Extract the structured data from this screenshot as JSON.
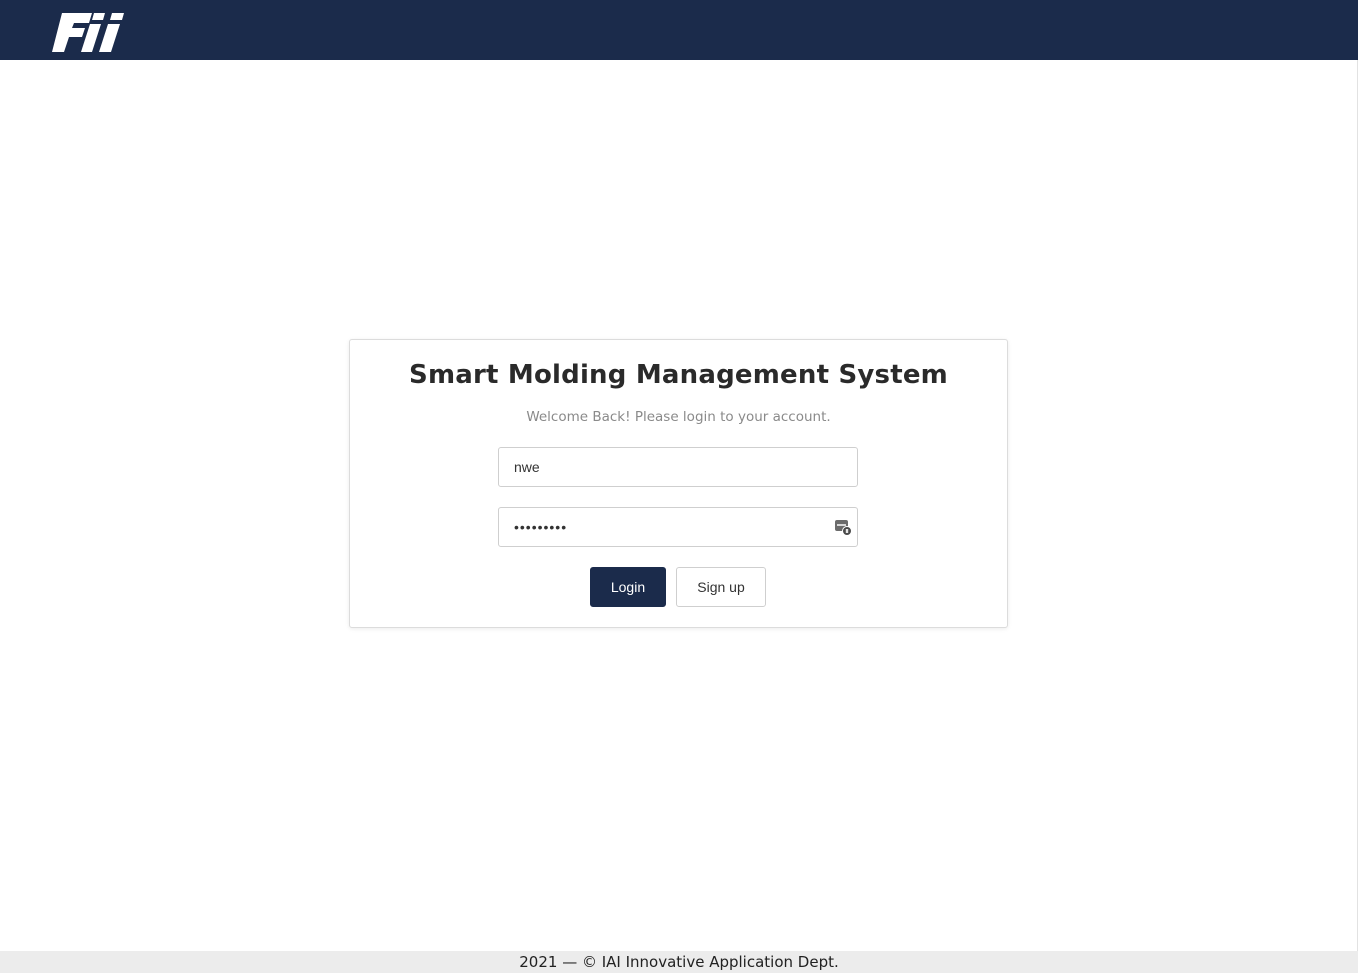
{
  "header": {
    "logo_text": "Fii",
    "background_color": "#1b2b4b"
  },
  "login": {
    "title": "Smart Molding Management System",
    "subtitle": "Welcome Back! Please login to your account.",
    "username_value": "nwe",
    "password_value": "nwe123456",
    "password_icon": "password-manager-key-icon",
    "login_label": "Login",
    "signup_label": "Sign up"
  },
  "footer": {
    "text": "2021 — © IAI Innovative Application Dept."
  }
}
